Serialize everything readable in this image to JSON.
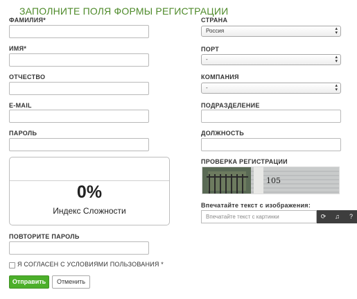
{
  "form_title": "ЗАПОЛНИТЕ ПОЛЯ ФОРМЫ РЕГИСТРАЦИИ",
  "left": {
    "surname_label": "ФАМИЛИЯ*",
    "name_label": "ИМЯ*",
    "patronymic_label": "ОТЧЕСТВО",
    "email_label": "E-MAIL",
    "password_label": "ПАРОЛЬ",
    "repeat_password_label": "ПОВТОРИТЕ ПАРОЛЬ"
  },
  "strength": {
    "value": "0%",
    "caption": "Индекс Сложности"
  },
  "right": {
    "country_label": "СТРАНА",
    "country_value": "Россия",
    "port_label": "ПОРТ",
    "port_value": "-",
    "company_label": "КОМПАНИЯ",
    "company_value": "-",
    "department_label": "ПОДРАЗДЕЛЕНИЕ",
    "position_label": "ДОЛЖНОСТЬ",
    "captcha_label": "ПРОВЕРКА РЕГИСТРАЦИИ",
    "captcha_prompt": "Впечатайте текст с изображения:",
    "captcha_placeholder": "Впечатайте текст с картинки",
    "captcha_image_text": "105"
  },
  "agree_text": "Я СОГЛАСЕН С УСЛОВИЯМИ ПОЛЬЗОВАНИЯ *",
  "buttons": {
    "submit": "Отправить",
    "cancel": "Отменить"
  },
  "colors": {
    "title_green": "#4e8a2a",
    "submit_green": "#4caf2a"
  },
  "icons": [
    "refresh-icon",
    "audio-icon",
    "help-icon"
  ]
}
